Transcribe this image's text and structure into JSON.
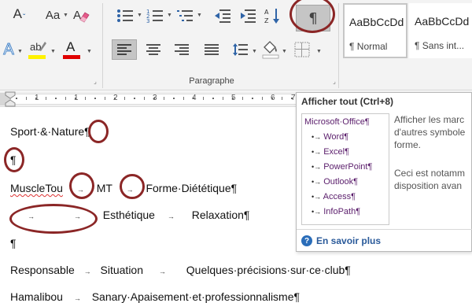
{
  "ribbon": {
    "font_size_down_glyph": "A",
    "change_case_label": "Aa",
    "text_effects_glyph": "A",
    "highlight_text": "ab",
    "font_color_glyph": "A",
    "show_all_glyph": "¶",
    "paragraph_group_label": "Paragraphe",
    "launcher_glyph": "⌟",
    "colors": {
      "highlight": "#fff200",
      "font_color": "#e00000",
      "accent_blue": "#1f5fa5"
    },
    "styles": [
      {
        "sample": "AaBbCcDd",
        "name": "¶ Normal"
      },
      {
        "sample": "AaBbCcDd",
        "name": "¶ Sans int..."
      }
    ]
  },
  "ruler": {
    "numbers": [
      "1",
      "1",
      "2",
      "3",
      "4",
      "5",
      "6",
      "7"
    ]
  },
  "document": {
    "line1": "Sport·&·Nature",
    "pilcrow": "¶",
    "line3_a": "MuscleTou",
    "line3_b": "MT",
    "line3_c": "Forme·Diététique¶",
    "tab_arrow": "→",
    "line4_a": "Esthétique",
    "line4_b": "Relaxation¶",
    "line6_a": "Responsable",
    "line6_b": "Situation",
    "line6_c": "Quelques·précisions·sur·ce·club¶",
    "line7_a": "Hamalibou",
    "line7_b": "Sanary·Apaisement·et·professionnalisme¶"
  },
  "tooltip": {
    "title": "Afficher tout (Ctrl+8)",
    "preview_lines": [
      {
        "text": "Microsoft·Office¶",
        "level": 0
      },
      {
        "text": "Word¶",
        "level": 1
      },
      {
        "text": "Excel¶",
        "level": 1
      },
      {
        "text": "PowerPoint¶",
        "level": 1
      },
      {
        "text": "Outlook¶",
        "level": 1
      },
      {
        "text": "Access¶",
        "level": 1
      },
      {
        "text": "InfoPath¶",
        "level": 1
      }
    ],
    "bullet_glyph": "•→",
    "description_1": "Afficher les marc d'autres symbole forme.",
    "description_2": "Ceci est notamm disposition avan",
    "learn_more": "En savoir plus",
    "help_glyph": "?"
  }
}
